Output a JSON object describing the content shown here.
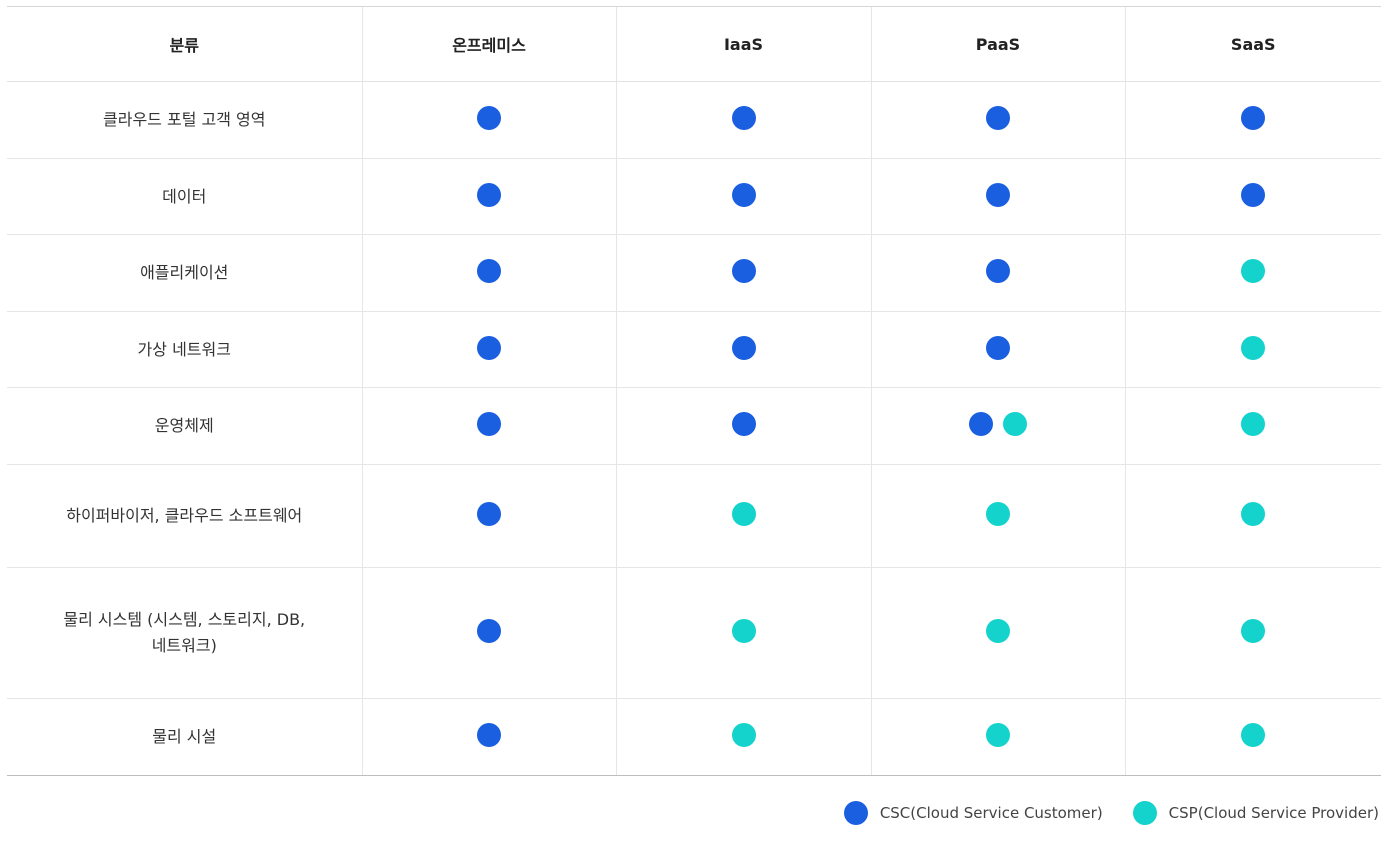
{
  "colors": {
    "csc": "#1a5fe0",
    "csp": "#14d3cc"
  },
  "table": {
    "headers": [
      "분류",
      "온프레미스",
      "IaaS",
      "PaaS",
      "SaaS"
    ],
    "rows": [
      {
        "category": "클라우드 포털 고객 영역",
        "cells": [
          [
            "csc"
          ],
          [
            "csc"
          ],
          [
            "csc"
          ],
          [
            "csc"
          ]
        ]
      },
      {
        "category": "데이터",
        "cells": [
          [
            "csc"
          ],
          [
            "csc"
          ],
          [
            "csc"
          ],
          [
            "csc"
          ]
        ]
      },
      {
        "category": "애플리케이션",
        "cells": [
          [
            "csc"
          ],
          [
            "csc"
          ],
          [
            "csc"
          ],
          [
            "csp"
          ]
        ]
      },
      {
        "category": "가상 네트워크",
        "cells": [
          [
            "csc"
          ],
          [
            "csc"
          ],
          [
            "csc"
          ],
          [
            "csp"
          ]
        ]
      },
      {
        "category": "운영체제",
        "cells": [
          [
            "csc"
          ],
          [
            "csc"
          ],
          [
            "csc",
            "csp"
          ],
          [
            "csp"
          ]
        ]
      },
      {
        "category": "하이퍼바이저, 클라우드 소프트웨어",
        "cells": [
          [
            "csc"
          ],
          [
            "csp"
          ],
          [
            "csp"
          ],
          [
            "csp"
          ]
        ]
      },
      {
        "category": "물리 시스템 (시스템, 스토리지, DB, 네트워크)",
        "cells": [
          [
            "csc"
          ],
          [
            "csp"
          ],
          [
            "csp"
          ],
          [
            "csp"
          ]
        ]
      },
      {
        "category": "물리 시설",
        "cells": [
          [
            "csc"
          ],
          [
            "csp"
          ],
          [
            "csp"
          ],
          [
            "csp"
          ]
        ]
      }
    ]
  },
  "legend": {
    "csc_label": "CSC(Cloud Service Customer)",
    "csp_label": "CSP(Cloud Service Provider)"
  }
}
